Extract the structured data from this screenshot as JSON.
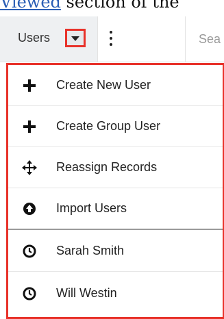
{
  "doc": {
    "link_text": "Viewed",
    "rest_text": " section of the"
  },
  "navbar": {
    "module_label": "Users",
    "search_placeholder": "Sea"
  },
  "menu": {
    "items": [
      {
        "label": "Create New User",
        "icon": "plus-icon"
      },
      {
        "label": "Create Group User",
        "icon": "plus-icon"
      },
      {
        "label": "Reassign Records",
        "icon": "move-arrows-icon"
      },
      {
        "label": "Import Users",
        "icon": "upload-circle-icon"
      },
      {
        "label": "Sarah Smith",
        "icon": "clock-icon"
      },
      {
        "label": "Will Westin",
        "icon": "clock-icon"
      }
    ]
  },
  "colors": {
    "highlight": "#e8322a",
    "tab_bg": "#eef0f2"
  }
}
